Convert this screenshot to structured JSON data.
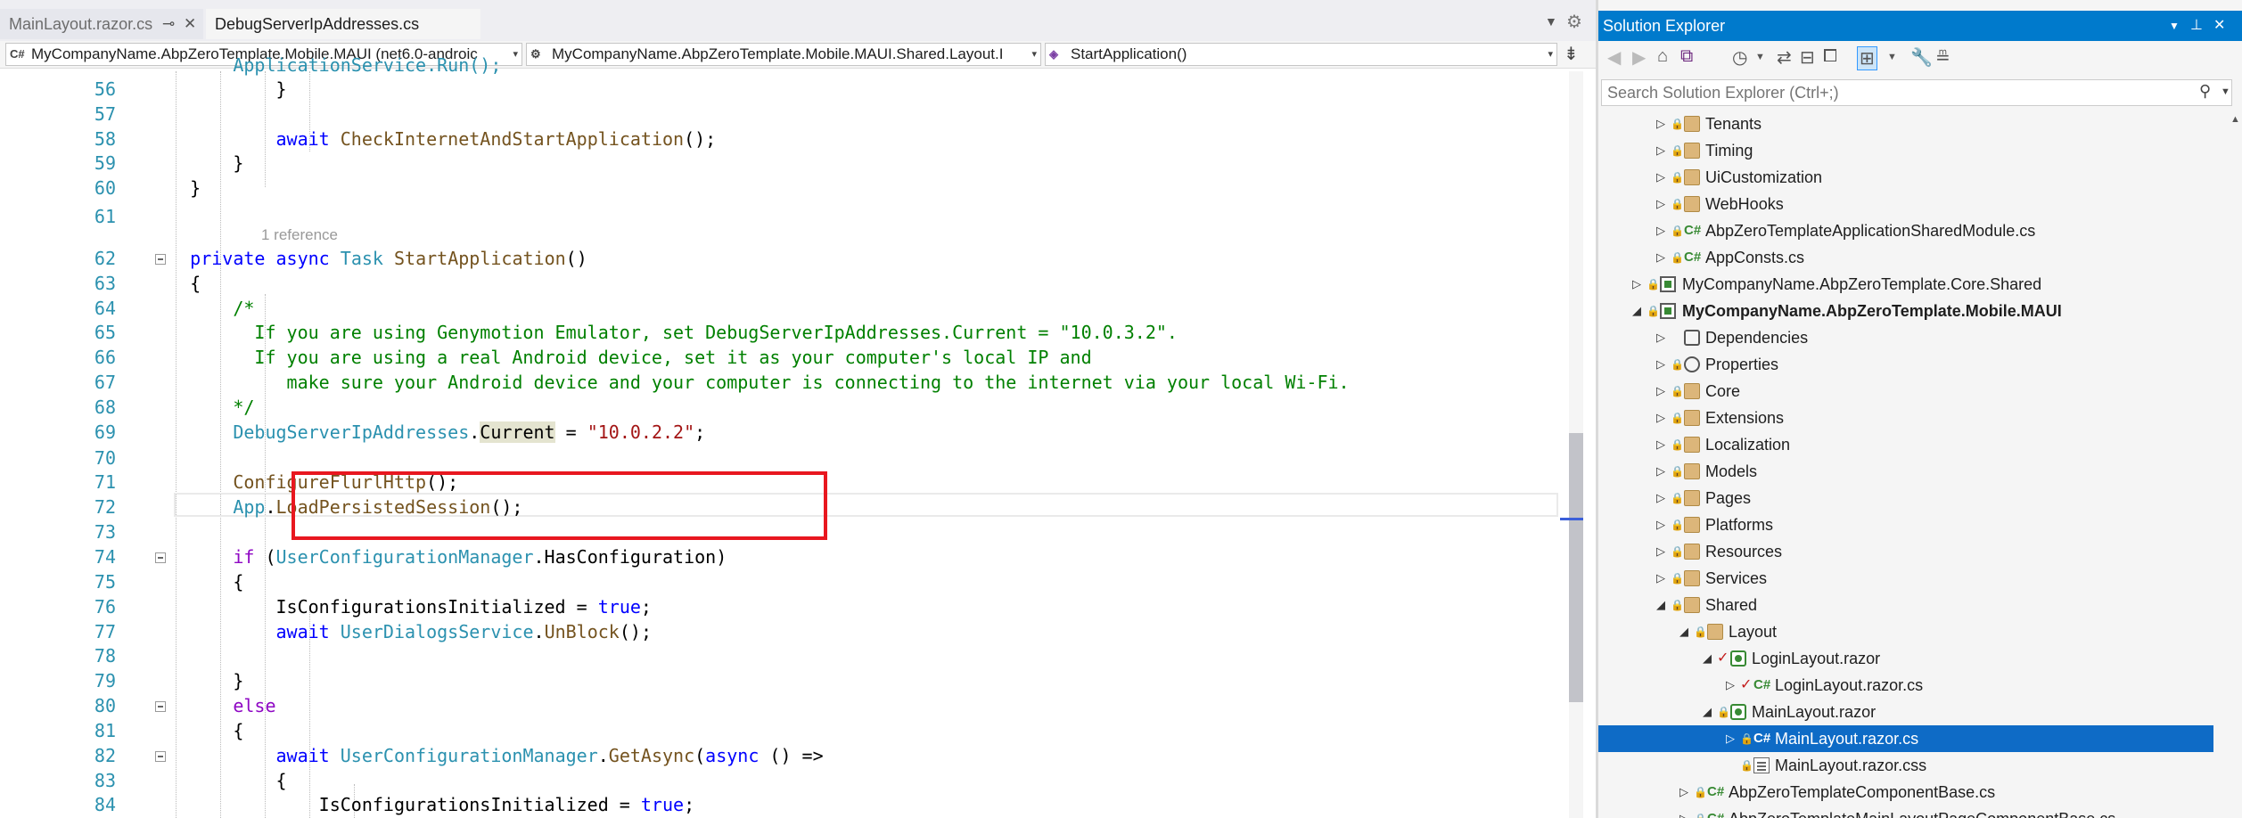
{
  "tabs": [
    {
      "label": "MainLayout.razor.cs",
      "active": false
    },
    {
      "label": "DebugServerIpAddresses.cs",
      "active": true
    }
  ],
  "navbar": {
    "project": "MyCompanyName.AbpZeroTemplate.Mobile.MAUI (net6.0-androic",
    "type": "MyCompanyName.AbpZeroTemplate.Mobile.MAUI.Shared.Layout.I",
    "member": "StartApplication()"
  },
  "code": {
    "lines": [
      {
        "n": "56",
        "text": "            }"
      },
      {
        "n": "57",
        "text": ""
      },
      {
        "n": "58",
        "text": "            await CheckInternetAndStartApplication();"
      },
      {
        "n": "59",
        "text": "        }"
      },
      {
        "n": "60",
        "text": "    }"
      },
      {
        "n": "61",
        "text": ""
      },
      {
        "n": "62",
        "text": "    private async Task StartApplication()"
      },
      {
        "n": "63",
        "text": "    {"
      },
      {
        "n": "64",
        "text": "        /*"
      },
      {
        "n": "65",
        "text": "          If you are using Genymotion Emulator, set DebugServerIpAddresses.Current = \"10.0.3.2\"."
      },
      {
        "n": "66",
        "text": "          If you are using a real Android device, set it as your computer's local IP and"
      },
      {
        "n": "67",
        "text": "             make sure your Android device and your computer is connecting to the internet via your local Wi-Fi."
      },
      {
        "n": "68",
        "text": "        */"
      },
      {
        "n": "69",
        "text": "        DebugServerIpAddresses.Current = \"10.0.2.2\";"
      },
      {
        "n": "70",
        "text": ""
      },
      {
        "n": "71",
        "text": "        ConfigureFlurlHttp();"
      },
      {
        "n": "72",
        "text": "        App.LoadPersistedSession();"
      },
      {
        "n": "73",
        "text": ""
      },
      {
        "n": "74",
        "text": "        if (UserConfigurationManager.HasConfiguration)"
      },
      {
        "n": "75",
        "text": "        {"
      },
      {
        "n": "76",
        "text": "            IsConfigurationsInitialized = true;"
      },
      {
        "n": "77",
        "text": "            await UserDialogsService.UnBlock();"
      },
      {
        "n": "78",
        "text": ""
      },
      {
        "n": "79",
        "text": "        }"
      },
      {
        "n": "80",
        "text": "        else"
      },
      {
        "n": "81",
        "text": "        {"
      },
      {
        "n": "82",
        "text": "            await UserConfigurationManager.GetAsync(async () =>"
      },
      {
        "n": "83",
        "text": "            {"
      },
      {
        "n": "84",
        "text": "                IsConfigurationsInitialized = true;"
      }
    ],
    "partial_line_text": "        ApplicationService.Run();",
    "codelens": "1 reference",
    "highlighted_line": "69"
  },
  "explorer": {
    "title": "Solution Explorer",
    "search_placeholder": "Search Solution Explorer (Ctrl+;)",
    "tree": [
      {
        "label": "Tenants",
        "icon": "folder"
      },
      {
        "label": "Timing",
        "icon": "folder"
      },
      {
        "label": "UiCustomization",
        "icon": "folder"
      },
      {
        "label": "WebHooks",
        "icon": "folder"
      },
      {
        "label": "AbpZeroTemplateApplicationSharedModule.cs",
        "icon": "csharp"
      },
      {
        "label": "AppConsts.cs",
        "icon": "csharp"
      },
      {
        "label": "MyCompanyName.AbpZeroTemplate.Core.Shared",
        "icon": "project"
      },
      {
        "label": "MyCompanyName.AbpZeroTemplate.Mobile.MAUI",
        "icon": "project"
      },
      {
        "label": "Dependencies",
        "icon": "dependencies"
      },
      {
        "label": "Properties",
        "icon": "properties"
      },
      {
        "label": "Core",
        "icon": "folder"
      },
      {
        "label": "Extensions",
        "icon": "folder"
      },
      {
        "label": "Localization",
        "icon": "folder"
      },
      {
        "label": "Models",
        "icon": "folder"
      },
      {
        "label": "Pages",
        "icon": "folder"
      },
      {
        "label": "Platforms",
        "icon": "folder"
      },
      {
        "label": "Resources",
        "icon": "folder"
      },
      {
        "label": "Services",
        "icon": "folder"
      },
      {
        "label": "Shared",
        "icon": "folder"
      },
      {
        "label": "Layout",
        "icon": "folder"
      },
      {
        "label": "LoginLayout.razor",
        "icon": "razor"
      },
      {
        "label": "LoginLayout.razor.cs",
        "icon": "csharp"
      },
      {
        "label": "MainLayout.razor",
        "icon": "razor"
      },
      {
        "label": "MainLayout.razor.cs",
        "icon": "csharp"
      },
      {
        "label": "MainLayout.razor.css",
        "icon": "css"
      },
      {
        "label": "AbpZeroTemplateComponentBase.cs",
        "icon": "csharp"
      },
      {
        "label": "AbpZeroTemplateMainLayoutPageComponentBase.cs",
        "icon": "csharp"
      }
    ],
    "selected_item": "MainLayout.razor.cs",
    "csharp_glyph": "C#"
  },
  "colors": {
    "accent": "#007acc",
    "selection": "#0e6bc6",
    "highlight_box": "#e8171f",
    "keyword": "#0000ff",
    "type": "#2b91af",
    "string": "#a31515",
    "comment": "#008000"
  }
}
